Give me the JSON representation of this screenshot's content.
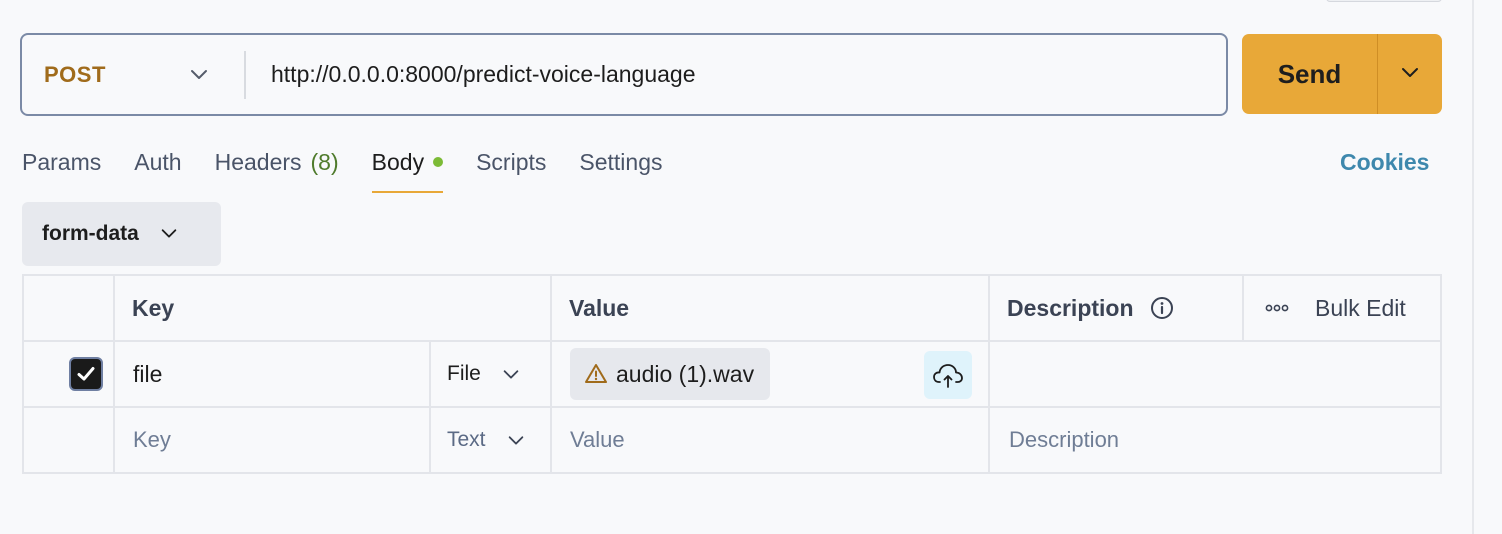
{
  "request": {
    "method": "POST",
    "url": "http://0.0.0.0:8000/predict-voice-language",
    "send_label": "Send"
  },
  "tabs": [
    {
      "label": "Params"
    },
    {
      "label": "Auth"
    },
    {
      "label": "Headers",
      "count": "(8)"
    },
    {
      "label": "Body",
      "active": true,
      "indicator_color": "#7cbb36"
    },
    {
      "label": "Scripts"
    },
    {
      "label": "Settings"
    }
  ],
  "cookies_label": "Cookies",
  "body_type": "form-data",
  "table": {
    "headers": {
      "key": "Key",
      "value": "Value",
      "description": "Description",
      "bulk_edit": "Bulk Edit"
    },
    "rows": [
      {
        "checked": true,
        "key": "file",
        "type": "File",
        "value": "audio (1).wav",
        "value_status": "warning-icon",
        "description": ""
      }
    ],
    "empty_row": {
      "key_placeholder": "Key",
      "type": "Text",
      "value_placeholder": "Value",
      "description_placeholder": "Description"
    }
  },
  "colors": {
    "accent": "#e8a838",
    "method": "#a06b1b",
    "cookies": "#3e88ad",
    "headers_count": "#4f7b2c"
  },
  "icons": [
    "chevron-down-icon",
    "check-icon",
    "warning-icon",
    "cloud-upload-icon",
    "info-icon",
    "more-dots-icon"
  ]
}
